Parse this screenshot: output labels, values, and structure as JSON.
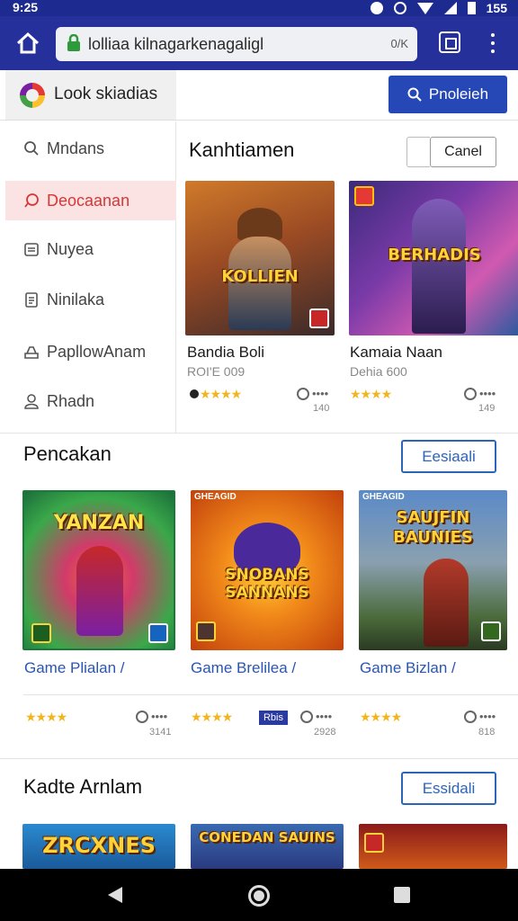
{
  "status": {
    "time": "9:25",
    "battery": "155"
  },
  "browser": {
    "url": "lolliaa kilnagarkenagaligl",
    "url_suffix": "0/K"
  },
  "header": {
    "brand": "Look skiadias",
    "search_label": "Pnoleieh"
  },
  "sidebar": {
    "items": [
      {
        "label": "Mndans",
        "icon": "search-icon"
      },
      {
        "label": "Deocaanan",
        "icon": "chat-icon"
      },
      {
        "label": "Nuyea",
        "icon": "list-icon"
      },
      {
        "label": "Ninilaka",
        "icon": "document-icon"
      },
      {
        "label": "PapllowAnam",
        "icon": "tray-icon"
      },
      {
        "label": "Rhadn",
        "icon": "user-icon"
      }
    ]
  },
  "featured": {
    "title": "Kanhtiamen",
    "button": "Canel",
    "cards": [
      {
        "art_text": "KOLLIEN",
        "title": "Bandia Boli",
        "sub": "ROI'E 009",
        "stars": "★★★★",
        "comments": "••••",
        "count": "140"
      },
      {
        "art_text": "BERHADIS",
        "title": "Kamaia Naan",
        "sub": "Dehia 600",
        "stars": "★★★★",
        "comments": "••••",
        "count": "149"
      }
    ]
  },
  "section2": {
    "title": "Pencakan",
    "button": "Eesiaali",
    "cards": [
      {
        "art_text": "YANZAN",
        "link": "Game Plialan /",
        "stars": "★★★★",
        "comments": "••••",
        "count": "3141"
      },
      {
        "art_text": "SNOBANS SANNANS",
        "corner_label": "GHEAGID",
        "link": "Game Brelilea /",
        "stars": "★★★★",
        "tag": "Rbis",
        "comments": "••••",
        "count": "2928"
      },
      {
        "art_text": "SAUJFIN BAUNIES",
        "corner_label": "GHEAGID",
        "link": "Game Bizlan /",
        "stars": "★★★★",
        "comments": "••••",
        "count": "818"
      }
    ]
  },
  "section3": {
    "title": "Kadte Arnlam",
    "button": "Essidali",
    "cards": [
      {
        "art_text": "ZRCXNES"
      },
      {
        "art_text": "CONEDAN SAUINS"
      },
      {
        "art_text": ""
      }
    ]
  },
  "colors": {
    "accent": "#2548b6",
    "bar": "#25309a",
    "active": "#d93636"
  }
}
